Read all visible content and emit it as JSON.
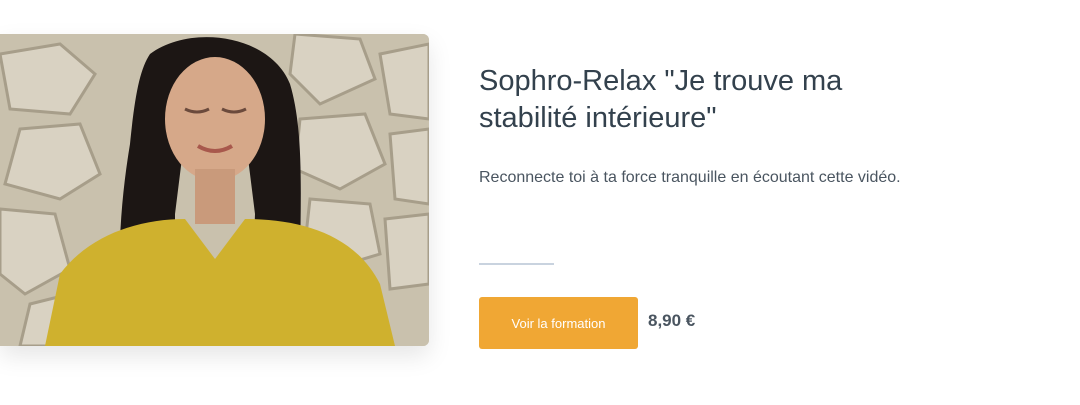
{
  "course": {
    "title": "Sophro-Relax \"Je trouve ma stabilité intérieure\"",
    "description": "Reconnecte toi à ta force tranquille en écoutant cette vidéo.",
    "cta_label": "Voir la formation",
    "price": "8,90 €"
  },
  "colors": {
    "accent": "#f0a734",
    "title": "#33414d",
    "text": "#4a5560",
    "divider": "#c9d3df"
  }
}
